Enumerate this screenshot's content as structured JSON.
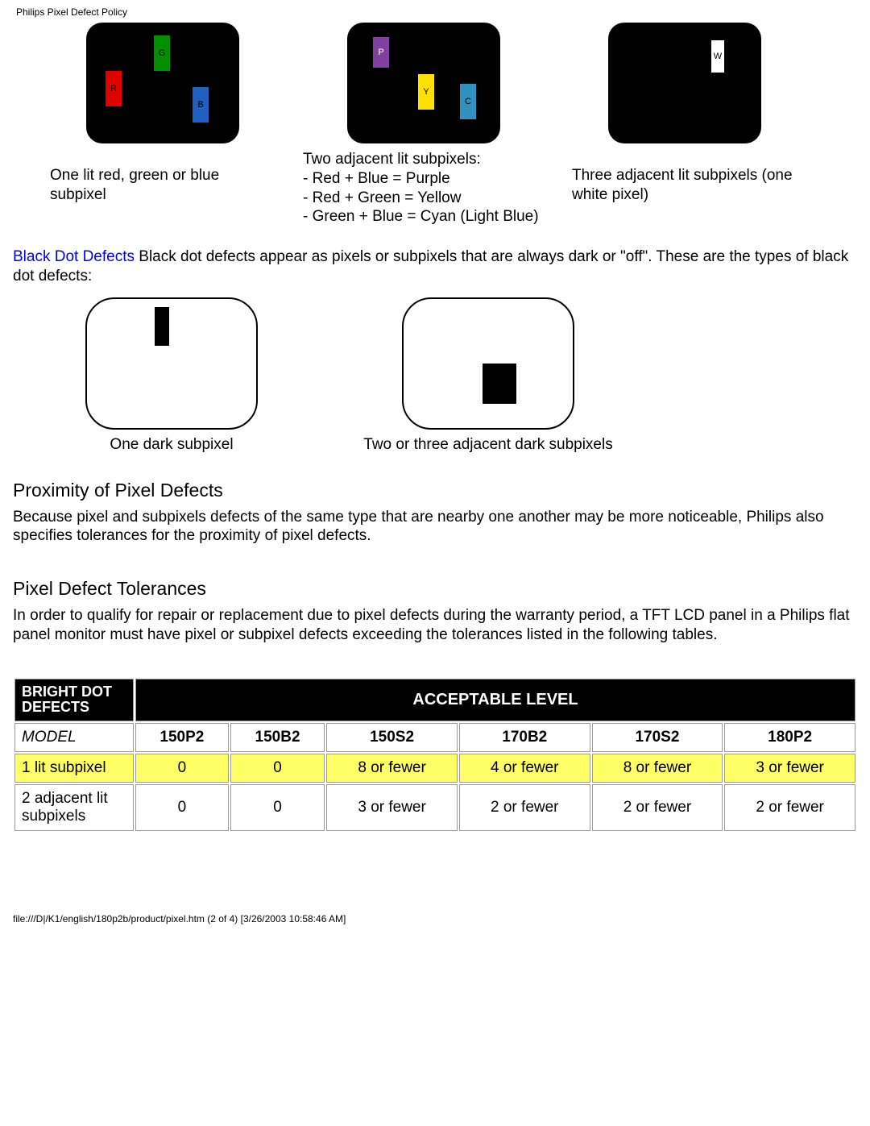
{
  "header": "Philips Pixel Defect Policy",
  "diagrams": {
    "rgb": {
      "r": "R",
      "g": "G",
      "b": "B"
    },
    "pyc": {
      "p": "P",
      "y": "Y",
      "c": "C"
    },
    "w": "W"
  },
  "captions": {
    "one_lit": "One lit red, green or blue subpixel",
    "two_adj_title": "Two adjacent lit subpixels:",
    "two_adj_1": "- Red + Blue = Purple",
    "two_adj_2": "- Red + Green = Yellow",
    "two_adj_3": "- Green + Blue = Cyan (Light Blue)",
    "three_adj": "Three adjacent lit subpixels (one white pixel)"
  },
  "black_defects": {
    "label": "Black Dot Defects",
    "text": " Black dot defects appear as pixels or subpixels that are always dark or \"off\". These are the types of black dot defects:",
    "one_dark": "One dark subpixel",
    "two_three_dark": "Two or three adjacent dark subpixels"
  },
  "proximity": {
    "heading": "Proximity of Pixel Defects",
    "body": "Because pixel and subpixels defects of the same type that are nearby one another may be more noticeable, Philips also specifies tolerances for the proximity of pixel defects."
  },
  "tolerances": {
    "heading": "Pixel Defect Tolerances",
    "body": "In order to qualify for repair or replacement due to pixel defects during the warranty period, a TFT LCD panel in a Philips flat panel monitor must have pixel or subpixel defects exceeding the tolerances listed in the following tables."
  },
  "chart_data": {
    "type": "table",
    "title_left": "BRIGHT DOT DEFECTS",
    "title_right": "ACCEPTABLE LEVEL",
    "model_label": "MODEL",
    "models": [
      "150P2",
      "150B2",
      "150S2",
      "170B2",
      "170S2",
      "180P2"
    ],
    "rows": [
      {
        "label": "1 lit subpixel",
        "highlight": true,
        "values": [
          "0",
          "0",
          "8 or fewer",
          "4 or fewer",
          "8 or fewer",
          "3 or fewer"
        ]
      },
      {
        "label": "2 adjacent lit subpixels",
        "highlight": false,
        "values": [
          "0",
          "0",
          "3 or fewer",
          "2 or fewer",
          "2 or fewer",
          "2 or fewer"
        ]
      }
    ]
  },
  "footer": "file:///D|/K1/english/180p2b/product/pixel.htm (2 of 4) [3/26/2003 10:58:46 AM]"
}
